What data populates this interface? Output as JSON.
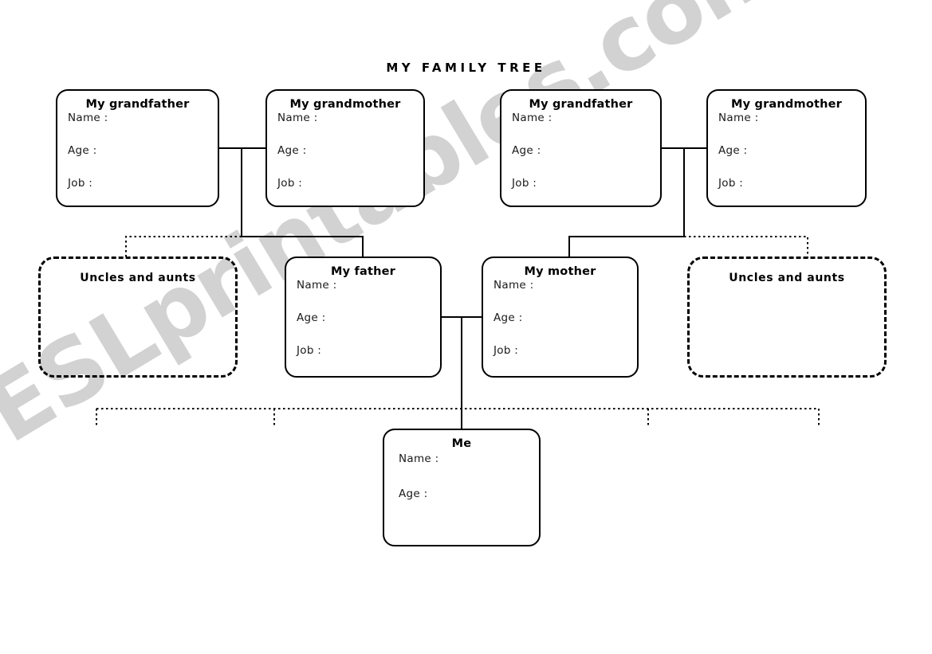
{
  "page": {
    "title": "MY FAMILY TREE",
    "watermark": "ESLprintables.com",
    "ink_color": "#000000",
    "watermark_color": "#d2d2d2",
    "background_color": "#ffffff"
  },
  "nodes": {
    "paternal_grandfather": {
      "title": "My grandfather",
      "fields": [
        "Name :",
        "Age :",
        "Job :"
      ],
      "border": "solid"
    },
    "paternal_grandmother": {
      "title": "My grandmother",
      "fields": [
        "Name :",
        "Age :",
        "Job :"
      ],
      "border": "solid"
    },
    "maternal_grandfather": {
      "title": "My grandfather",
      "fields": [
        "Name :",
        "Age :",
        "Job :"
      ],
      "border": "solid"
    },
    "maternal_grandmother": {
      "title": "My grandmother",
      "fields": [
        "Name :",
        "Age :",
        "Job :"
      ],
      "border": "solid"
    },
    "paternal_uncles_aunts": {
      "title": "Uncles and aunts",
      "fields": [],
      "border": "dashed"
    },
    "father": {
      "title": "My father",
      "fields": [
        "Name :",
        "Age :",
        "Job :"
      ],
      "border": "solid"
    },
    "mother": {
      "title": "My mother",
      "fields": [
        "Name :",
        "Age :",
        "Job :"
      ],
      "border": "solid"
    },
    "maternal_uncles_aunts": {
      "title": "Uncles and aunts",
      "fields": [],
      "border": "dashed"
    },
    "me": {
      "title": "Me",
      "fields": [
        "Name :",
        "Age :"
      ],
      "border": "solid"
    }
  }
}
